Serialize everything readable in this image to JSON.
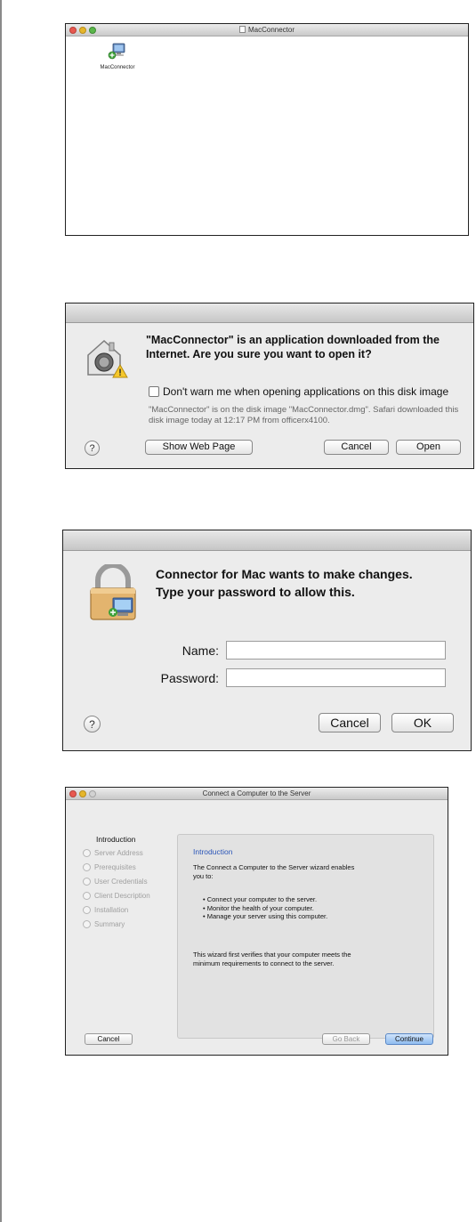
{
  "finder_window": {
    "title": "MacConnector",
    "item_label": "MacConnector"
  },
  "gatekeeper_dialog": {
    "message": "\"MacConnector\" is an application downloaded from the Internet. Are you sure you want to open it?",
    "checkbox_label": "Don't warn me when opening applications on this disk image",
    "detail": "\"MacConnector\" is on the disk image \"MacConnector.dmg\". Safari downloaded this disk image today at 12:17 PM from officerx4100.",
    "help": "?",
    "show_web_page": "Show Web Page",
    "cancel": "Cancel",
    "open": "Open"
  },
  "auth_dialog": {
    "message_line1": "Connector for Mac wants to make changes.",
    "message_line2": "Type your password to allow this.",
    "name_label": "Name:",
    "password_label": "Password:",
    "name_value": "",
    "password_value": "",
    "help": "?",
    "cancel": "Cancel",
    "ok": "OK"
  },
  "wizard": {
    "title": "Connect a Computer to the Server",
    "steps_title": "Introduction",
    "steps": [
      "Server Address",
      "Prerequisites",
      "User Credentials",
      "Client Description",
      "Installation",
      "Summary"
    ],
    "heading": "Introduction",
    "intro_line1": "The Connect a Computer to the Server wizard enables",
    "intro_line2": "you to:",
    "bullets": [
      "• Connect your computer to the server.",
      "• Monitor the health of your computer.",
      "• Manage your server using this computer."
    ],
    "outro_line1": "This wizard first verifies that your computer meets the",
    "outro_line2": "minimum requirements to connect to the server.",
    "cancel": "Cancel",
    "go_back": "Go Back",
    "continue": "Continue"
  },
  "colors": {
    "link_blue": "#2a55b8",
    "primary_button": "#8fbcf0"
  }
}
